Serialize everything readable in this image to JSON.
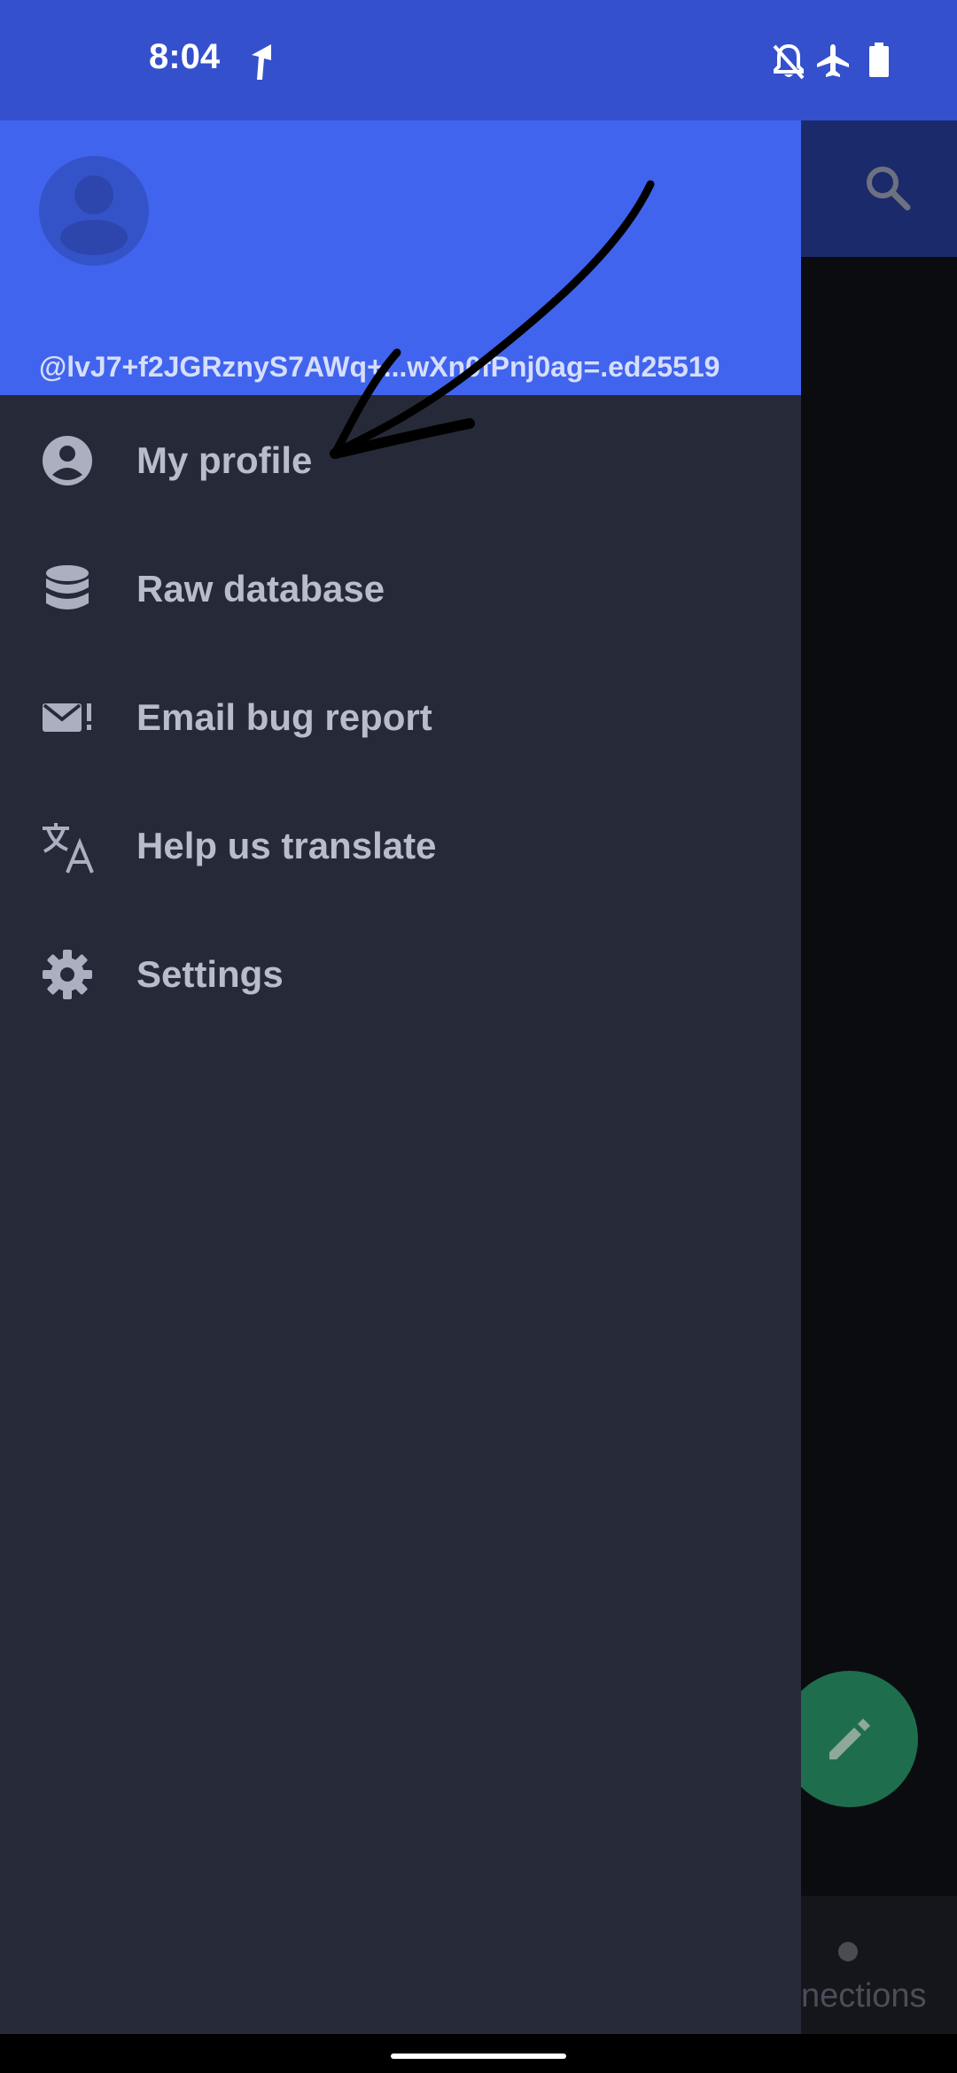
{
  "status_bar": {
    "time": "8:04",
    "icons": [
      "navigation-icon",
      "notifications-off-icon",
      "airplane-mode-icon",
      "battery-icon"
    ]
  },
  "drawer": {
    "account_id": "@lvJ7+f2JGRznyS7AWq+...wXn0fPnj0ag=.ed25519",
    "menu_items": [
      {
        "label": "My profile",
        "icon": "account-circle-icon"
      },
      {
        "label": "Raw database",
        "icon": "database-icon"
      },
      {
        "label": "Email bug report",
        "icon": "email-alert-icon"
      },
      {
        "label": "Help us translate",
        "icon": "translate-icon"
      },
      {
        "label": "Settings",
        "icon": "gear-icon"
      }
    ]
  },
  "background_app": {
    "bottom_nav_label": "nections"
  },
  "colors": {
    "status_bar": "#3550cc",
    "drawer_header": "#4164ee",
    "drawer_bg": "#262a38",
    "menu_text": "#b8bdcc",
    "fab": "#1e6e4e"
  }
}
